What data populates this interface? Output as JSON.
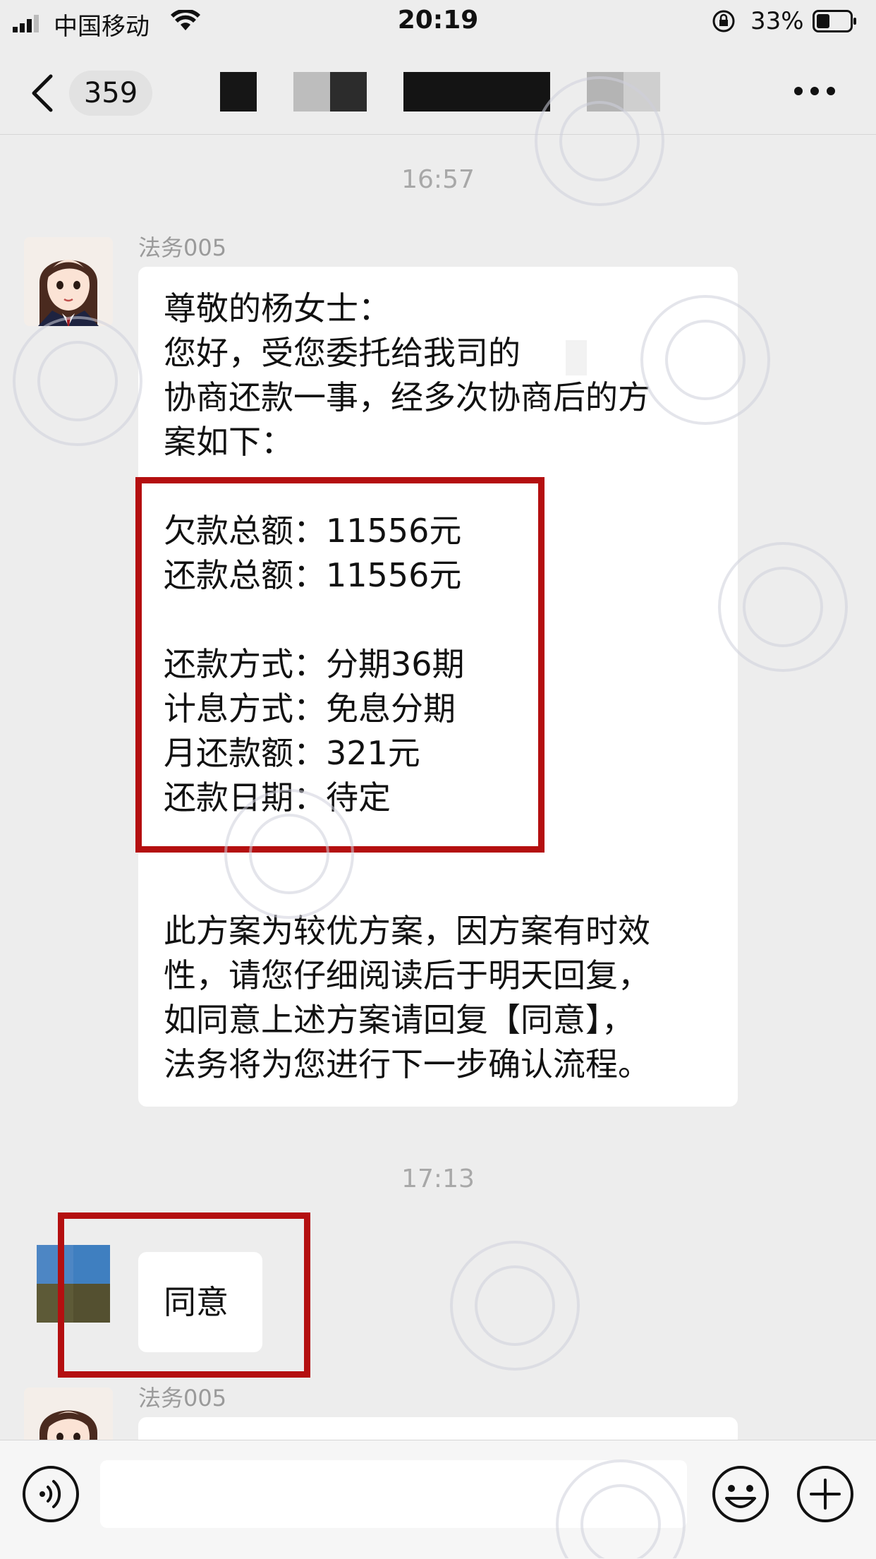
{
  "status_bar": {
    "carrier": "中国移动",
    "time": "20:19",
    "battery_pct": "33%"
  },
  "nav": {
    "unread_count": "359"
  },
  "chat": {
    "timestamp_1": "16:57",
    "timestamp_2": "17:13",
    "sender_name": "法务005",
    "sender_name_2": "法务005",
    "message_1": {
      "greeting": "尊敬的杨女士：",
      "intro": [
        "您好，受您委托给我司的",
        "协商还款一事，经多次协商后的方",
        "案如下："
      ],
      "plan": [
        "欠款总额：11556元",
        "还款总额：11556元",
        "",
        "还款方式：分期36期",
        "计息方式：免息分期",
        "月还款额：321元",
        "还款日期：待定"
      ],
      "closing": [
        "此方案为较优方案，因方案有时效",
        "性，请您仔细阅读后于明天回复，",
        "如同意上述方案请回复【同意】，",
        "法务将为您进行下一步确认流程。"
      ]
    },
    "reply": "同意"
  },
  "colors": {
    "background": "#ededed",
    "bubble": "#ffffff",
    "highlight_box": "#b40f10",
    "timestamp": "#a8a8a8"
  },
  "icons": {
    "back": "chevron-left-icon",
    "more": "more-dots-icon",
    "voice": "voice-icon",
    "emoji": "emoji-icon",
    "plus": "plus-icon"
  }
}
